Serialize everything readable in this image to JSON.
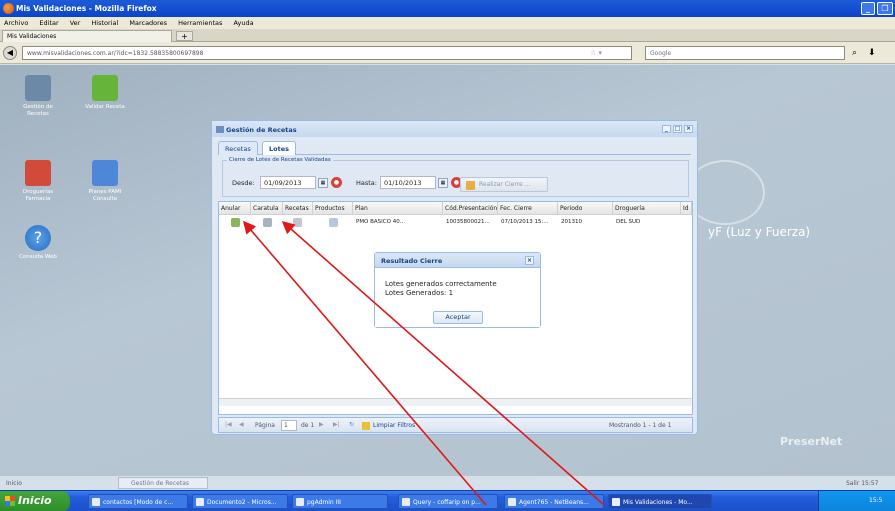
{
  "browser": {
    "window_title": "Mis Validaciones - Mozilla Firefox",
    "menu": [
      "Archivo",
      "Editar",
      "Ver",
      "Historial",
      "Marcadores",
      "Herramientas",
      "Ayuda"
    ],
    "tab_label": "Mis Validaciones",
    "new_tab": "+",
    "url": "www.misvalidaciones.com.ar/?idc=1832.58835800697898",
    "search_placeholder": "Google"
  },
  "desktop": {
    "icons": [
      {
        "label": "Gestión de Recetas",
        "icon": "prescriptions-icon"
      },
      {
        "label": "Validar Receta",
        "icon": "thumbs-up-icon"
      },
      {
        "label": "Droguerías Farmacia",
        "icon": "folder-icon"
      },
      {
        "label": "Planes PAMI Consulta",
        "icon": "calendar-icon"
      },
      {
        "label": "Consulta Web",
        "icon": "help-icon"
      }
    ],
    "brand": "yF (Luz y Fuerza)",
    "footer_brand": "PreserNet"
  },
  "window": {
    "title": "Gestión de Recetas",
    "tabs": [
      "Recetas",
      "Lotes"
    ],
    "fieldset_legend": "Cierre de Lotes de Recetas Validadas",
    "desde_label": "Desde:",
    "desde_value": "01/09/2013",
    "hasta_label": "Hasta:",
    "hasta_value": "01/10/2013",
    "realizar_label": "Realizar Cierre ..."
  },
  "grid": {
    "columns": [
      "Anular",
      "Caratula",
      "Recetas",
      "Productos",
      "Plan",
      "Cód.Presentación",
      "Fec. Cierre",
      "Periodo",
      "Droguería",
      "Id"
    ],
    "rows": [
      {
        "plan": "PMO BÁSICO 40...",
        "cod": "10035800021...",
        "fec": "07/10/2013 15:...",
        "periodo": "201310",
        "drogueria": "DEL SUD"
      }
    ]
  },
  "pager": {
    "page_label": "Página",
    "page_value": "1",
    "of_label": "de 1",
    "clear_filters": "Limpiar Filtros",
    "showing": "Mostrando 1 - 1 de 1"
  },
  "dialog": {
    "title": "Resultado Cierre",
    "line1": "Lotes generados correctamente",
    "line2": "Lotes Generados: 1",
    "ok_label": "Aceptar"
  },
  "statusbar": {
    "left": "Inicio",
    "task": "Gestión de Recetas",
    "right": "Salir 15:57"
  },
  "taskbar": {
    "start_label": "Inicio",
    "tasks": [
      "contactos [Modo de c...",
      "Documento2 - Micros...",
      "pgAdmin III",
      "Query - coffarip on p...",
      "Agent765 - NetBeans...",
      "Mis Validaciones - Mo..."
    ],
    "clock": "15:5"
  },
  "colors": {
    "accent": "#15428b",
    "arrow": "#e01818"
  }
}
